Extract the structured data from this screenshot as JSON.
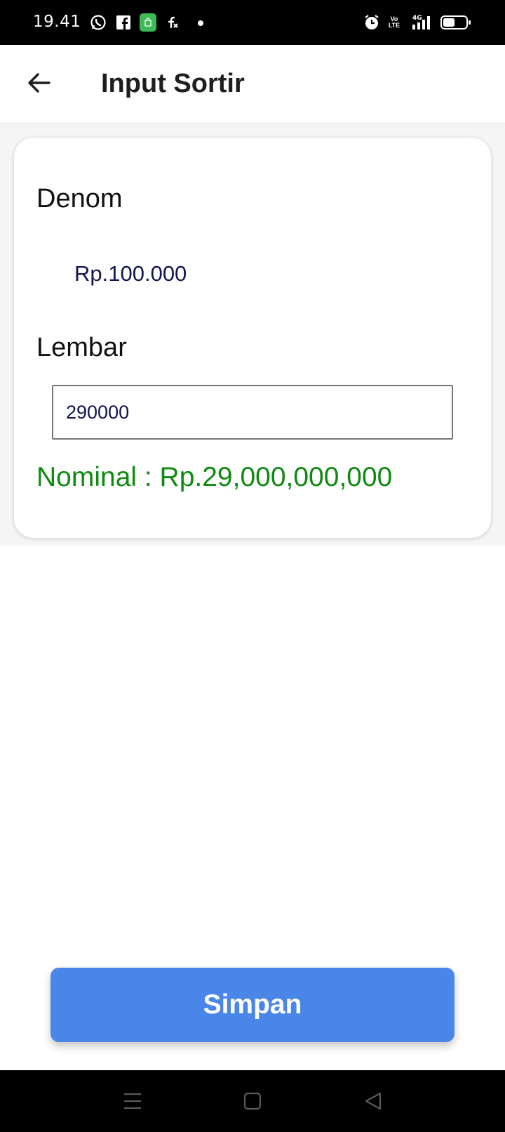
{
  "status_bar": {
    "time": "19.41",
    "icons": [
      "whatsapp-icon",
      "facebook-icon",
      "shop-icon",
      "fx-icon",
      "notification-dot",
      "alarm-icon",
      "volte-icon",
      "signal-4g-icon",
      "battery-icon"
    ],
    "volte_top": "Vo",
    "volte_bottom": "LTE",
    "network": "4G"
  },
  "app_bar": {
    "title": "Input Sortir",
    "back_icon": "arrow-left-icon"
  },
  "form": {
    "denom_label": "Denom",
    "denom_value": "Rp.100.000",
    "lembar_label": "Lembar",
    "lembar_value": "290000",
    "nominal_text": "Nominal : Rp.29,000,000,000"
  },
  "actions": {
    "save_label": "Simpan"
  },
  "colors": {
    "primary_button": "#4a86e8",
    "nominal_green": "#0f8a10",
    "value_navy": "#141450"
  },
  "nav_bar": {
    "buttons": [
      "menu-icon",
      "home-icon",
      "back-triangle-icon"
    ]
  }
}
